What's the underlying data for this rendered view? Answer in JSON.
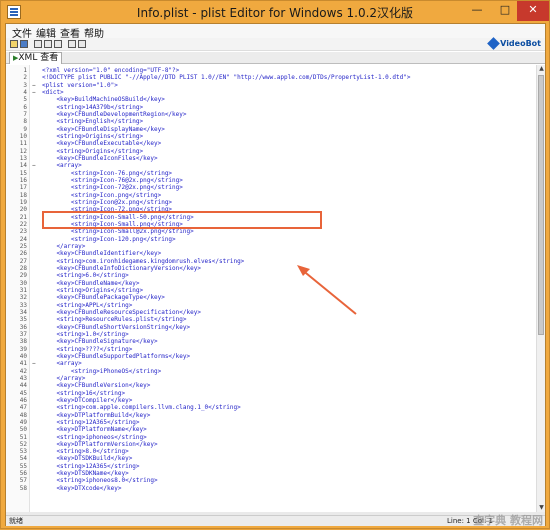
{
  "window": {
    "title": "Info.plist - plist Editor for Windows 1.0.2汉化版",
    "minimize": "—",
    "maximize": "□",
    "close": "✕"
  },
  "menu": [
    "文件",
    "编辑",
    "查看",
    "帮助"
  ],
  "logo": "VideoBot",
  "tab": "XML 查看",
  "status": {
    "left": "就绪",
    "right": "Line: 1 Col: 1"
  },
  "watermark": "查字典 教程网",
  "scroll": {
    "up": "▲",
    "down": "▼"
  },
  "lines": [
    {
      "n": "1",
      "f": "",
      "t": "<?xml version=\"1.0\" encoding=\"UTF-8\"?>"
    },
    {
      "n": "2",
      "f": "",
      "t": "<!DOCTYPE plist PUBLIC \"-//Apple//DTD PLIST 1.0//EN\" \"http://www.apple.com/DTDs/PropertyList-1.0.dtd\">"
    },
    {
      "n": "3",
      "f": "−",
      "t": "<plist version=\"1.0\">"
    },
    {
      "n": "4",
      "f": "−",
      "t": "<dict>"
    },
    {
      "n": "5",
      "f": "",
      "t": "    <key>BuildMachineOSBuild</key>"
    },
    {
      "n": "6",
      "f": "",
      "t": "    <string>14A379b</string>"
    },
    {
      "n": "7",
      "f": "",
      "t": "    <key>CFBundleDevelopmentRegion</key>"
    },
    {
      "n": "8",
      "f": "",
      "t": "    <string>English</string>"
    },
    {
      "n": "9",
      "f": "",
      "t": "    <key>CFBundleDisplayName</key>"
    },
    {
      "n": "10",
      "f": "",
      "t": "    <string>Origins</string>"
    },
    {
      "n": "11",
      "f": "",
      "t": "    <key>CFBundleExecutable</key>"
    },
    {
      "n": "12",
      "f": "",
      "t": "    <string>Origins</string>"
    },
    {
      "n": "13",
      "f": "",
      "t": "    <key>CFBundleIconFiles</key>"
    },
    {
      "n": "14",
      "f": "−",
      "t": "    <array>"
    },
    {
      "n": "15",
      "f": "",
      "t": "        <string>Icon-76.png</string>"
    },
    {
      "n": "16",
      "f": "",
      "t": "        <string>Icon-76@2x.png</string>"
    },
    {
      "n": "17",
      "f": "",
      "t": "        <string>Icon-72@2x.png</string>"
    },
    {
      "n": "18",
      "f": "",
      "t": "        <string>Icon.png</string>"
    },
    {
      "n": "19",
      "f": "",
      "t": "        <string>Icon@2x.png</string>"
    },
    {
      "n": "20",
      "f": "",
      "t": "        <string>Icon-72.png</string>"
    },
    {
      "n": "21",
      "f": "",
      "t": "        <string>Icon-Small-50.png</string>"
    },
    {
      "n": "22",
      "f": "",
      "t": "        <string>Icon-Small.png</string>"
    },
    {
      "n": "23",
      "f": "",
      "t": "        <string>Icon-Small@2x.png</string>"
    },
    {
      "n": "24",
      "f": "",
      "t": "        <string>Icon-120.png</string>"
    },
    {
      "n": "25",
      "f": "",
      "t": "    </array>"
    },
    {
      "n": "26",
      "f": "",
      "t": "    <key>CFBundleIdentifier</key>"
    },
    {
      "n": "27",
      "f": "",
      "t": "    <string>com.ironhidegames.kingdomrush.elves</string>"
    },
    {
      "n": "28",
      "f": "",
      "t": "    <key>CFBundleInfoDictionaryVersion</key>"
    },
    {
      "n": "29",
      "f": "",
      "t": "    <string>6.0</string>"
    },
    {
      "n": "30",
      "f": "",
      "t": "    <key>CFBundleName</key>"
    },
    {
      "n": "31",
      "f": "",
      "t": "    <string>Origins</string>"
    },
    {
      "n": "32",
      "f": "",
      "t": "    <key>CFBundlePackageType</key>"
    },
    {
      "n": "33",
      "f": "",
      "t": "    <string>APPL</string>"
    },
    {
      "n": "34",
      "f": "",
      "t": "    <key>CFBundleResourceSpecification</key>"
    },
    {
      "n": "35",
      "f": "",
      "t": "    <string>ResourceRules.plist</string>"
    },
    {
      "n": "36",
      "f": "",
      "t": "    <key>CFBundleShortVersionString</key>"
    },
    {
      "n": "37",
      "f": "",
      "t": "    <string>1.0</string>"
    },
    {
      "n": "38",
      "f": "",
      "t": "    <key>CFBundleSignature</key>"
    },
    {
      "n": "39",
      "f": "",
      "t": "    <string>????</string>"
    },
    {
      "n": "40",
      "f": "",
      "t": "    <key>CFBundleSupportedPlatforms</key>"
    },
    {
      "n": "41",
      "f": "−",
      "t": "    <array>"
    },
    {
      "n": "42",
      "f": "",
      "t": "        <string>iPhoneOS</string>"
    },
    {
      "n": "43",
      "f": "",
      "t": "    </array>"
    },
    {
      "n": "44",
      "f": "",
      "t": "    <key>CFBundleVersion</key>"
    },
    {
      "n": "45",
      "f": "",
      "t": "    <string>16</string>"
    },
    {
      "n": "46",
      "f": "",
      "t": "    <key>DTCompiler</key>"
    },
    {
      "n": "47",
      "f": "",
      "t": "    <string>com.apple.compilers.llvm.clang.1_0</string>"
    },
    {
      "n": "48",
      "f": "",
      "t": "    <key>DTPlatformBuild</key>"
    },
    {
      "n": "49",
      "f": "",
      "t": "    <string>12A365</string>"
    },
    {
      "n": "50",
      "f": "",
      "t": "    <key>DTPlatformName</key>"
    },
    {
      "n": "51",
      "f": "",
      "t": "    <string>iphoneos</string>"
    },
    {
      "n": "52",
      "f": "",
      "t": "    <key>DTPlatformVersion</key>"
    },
    {
      "n": "53",
      "f": "",
      "t": "    <string>8.0</string>"
    },
    {
      "n": "54",
      "f": "",
      "t": "    <key>DTSDKBuild</key>"
    },
    {
      "n": "55",
      "f": "",
      "t": "    <string>12A365</string>"
    },
    {
      "n": "56",
      "f": "",
      "t": "    <key>DTSDKName</key>"
    },
    {
      "n": "57",
      "f": "",
      "t": "    <string>iphoneos8.0</string>"
    },
    {
      "n": "58",
      "f": "",
      "t": "    <key>DTXcode</key>"
    }
  ]
}
